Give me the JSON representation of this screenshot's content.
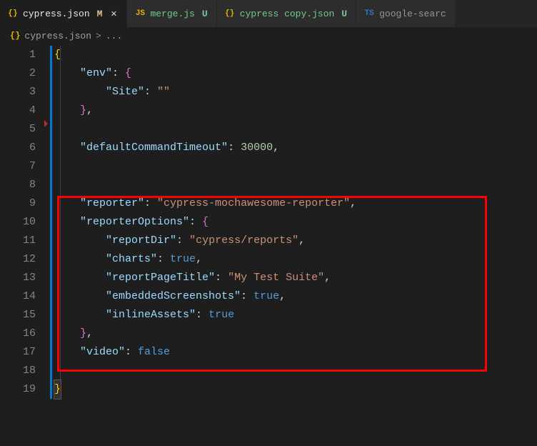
{
  "tabs": [
    {
      "iconColor": "#e0b400",
      "icon": "{}",
      "name": "cypress.json",
      "status": "M",
      "statusClass": "status-m",
      "active": true,
      "showClose": true
    },
    {
      "iconColor": "#e0b400",
      "icon": "JS",
      "name": "merge.js",
      "status": "U",
      "statusClass": "status-u",
      "active": false,
      "showClose": false
    },
    {
      "iconColor": "#e0b400",
      "icon": "{}",
      "name": "cypress copy.json",
      "status": "U",
      "statusClass": "status-u",
      "active": false,
      "showClose": false
    },
    {
      "iconColor": "#3178c6",
      "icon": "TS",
      "name": "google-searc",
      "status": "",
      "statusClass": "",
      "active": false,
      "showClose": false
    }
  ],
  "breadcrumb": {
    "icon": "{}",
    "file": "cypress.json",
    "sep": ">",
    "rest": "..."
  },
  "code": {
    "lines": [
      [
        [
          "brace-y",
          "{"
        ]
      ],
      [
        [
          "",
          "    "
        ],
        [
          "key",
          "\"env\""
        ],
        [
          "",
          ": "
        ],
        [
          "brace-p",
          "{"
        ]
      ],
      [
        [
          "",
          "        "
        ],
        [
          "key",
          "\"Site\""
        ],
        [
          "",
          ": "
        ],
        [
          "str",
          "\"\""
        ]
      ],
      [
        [
          "",
          "    "
        ],
        [
          "brace-p",
          "}"
        ],
        [
          "",
          ","
        ]
      ],
      [],
      [
        [
          "",
          "    "
        ],
        [
          "key",
          "\"defaultCommandTimeout\""
        ],
        [
          "",
          ": "
        ],
        [
          "num",
          "30000"
        ],
        [
          "",
          ","
        ]
      ],
      [],
      [],
      [
        [
          "",
          "    "
        ],
        [
          "key",
          "\"reporter\""
        ],
        [
          "",
          ": "
        ],
        [
          "str",
          "\"cypress-mochawesome-reporter\""
        ],
        [
          "",
          ","
        ]
      ],
      [
        [
          "",
          "    "
        ],
        [
          "key",
          "\"reporterOptions\""
        ],
        [
          "",
          ": "
        ],
        [
          "brace-p",
          "{"
        ]
      ],
      [
        [
          "",
          "        "
        ],
        [
          "key",
          "\"reportDir\""
        ],
        [
          "",
          ": "
        ],
        [
          "str",
          "\"cypress/reports\""
        ],
        [
          "",
          ","
        ]
      ],
      [
        [
          "",
          "        "
        ],
        [
          "key",
          "\"charts\""
        ],
        [
          "",
          ": "
        ],
        [
          "bool",
          "true"
        ],
        [
          "",
          ","
        ]
      ],
      [
        [
          "",
          "        "
        ],
        [
          "key",
          "\"reportPageTitle\""
        ],
        [
          "",
          ": "
        ],
        [
          "str",
          "\"My Test Suite\""
        ],
        [
          "",
          ","
        ]
      ],
      [
        [
          "",
          "        "
        ],
        [
          "key",
          "\"embeddedScreenshots\""
        ],
        [
          "",
          ": "
        ],
        [
          "bool",
          "true"
        ],
        [
          "",
          ","
        ]
      ],
      [
        [
          "",
          "        "
        ],
        [
          "key",
          "\"inlineAssets\""
        ],
        [
          "",
          ": "
        ],
        [
          "bool",
          "true"
        ]
      ],
      [
        [
          "",
          "    "
        ],
        [
          "brace-p",
          "}"
        ],
        [
          "",
          ","
        ]
      ],
      [
        [
          "",
          "    "
        ],
        [
          "key",
          "\"video\""
        ],
        [
          "",
          ": "
        ],
        [
          "bool",
          "false"
        ]
      ],
      [],
      [
        [
          "last",
          "}"
        ]
      ]
    ]
  }
}
